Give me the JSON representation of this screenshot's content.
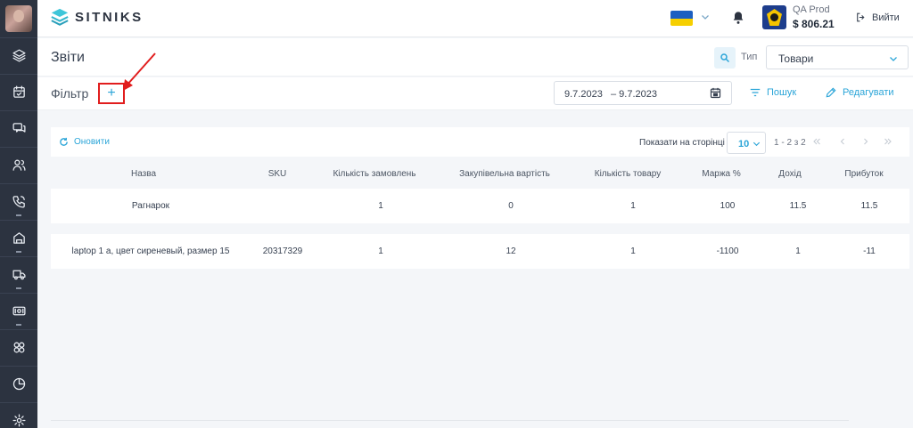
{
  "app": {
    "name": "SITNIKS"
  },
  "account": {
    "name": "QA Prod",
    "balance": "$ 806.21",
    "logout_label": "Вийти"
  },
  "page": {
    "title": "Звіти",
    "type_label": "Тип",
    "type_value": "Товари"
  },
  "filter": {
    "label": "Фільтр",
    "add_label": "+",
    "date_from": "9.7.2023",
    "date_to": "– 9.7.2023",
    "search_label": "Пошук",
    "edit_label": "Редагувати"
  },
  "toolbar": {
    "refresh_label": "Оновити",
    "per_page_label": "Показати на сторінці",
    "per_page_value": "10",
    "range_text": "1 - 2 з 2"
  },
  "table": {
    "headers": [
      "Назва",
      "SKU",
      "Кількість замовлень",
      "Закупівельна вартість",
      "Кількість товару",
      "Маржа %",
      "Дохід",
      "Прибуток"
    ],
    "rows": [
      [
        "Рагнарок",
        "",
        "1",
        "0",
        "1",
        "100",
        "11.5",
        "11.5"
      ],
      [
        "laptop 1 a, цвет сиреневый, размер 15",
        "20317329",
        "1",
        "12",
        "1",
        "-1100",
        "1",
        "-11"
      ]
    ]
  },
  "colors": {
    "accent": "#2ba5d8",
    "sidebar": "#2c3340",
    "highlight": "#e11d1d"
  },
  "sidebar": {
    "icons": [
      "layers-icon",
      "calendar-check-icon",
      "chat-icon",
      "users-icon",
      "phone-icon",
      "home-icon",
      "truck-icon",
      "cash-icon",
      "network-icon",
      "pie-chart-icon",
      "settings-icon"
    ]
  }
}
